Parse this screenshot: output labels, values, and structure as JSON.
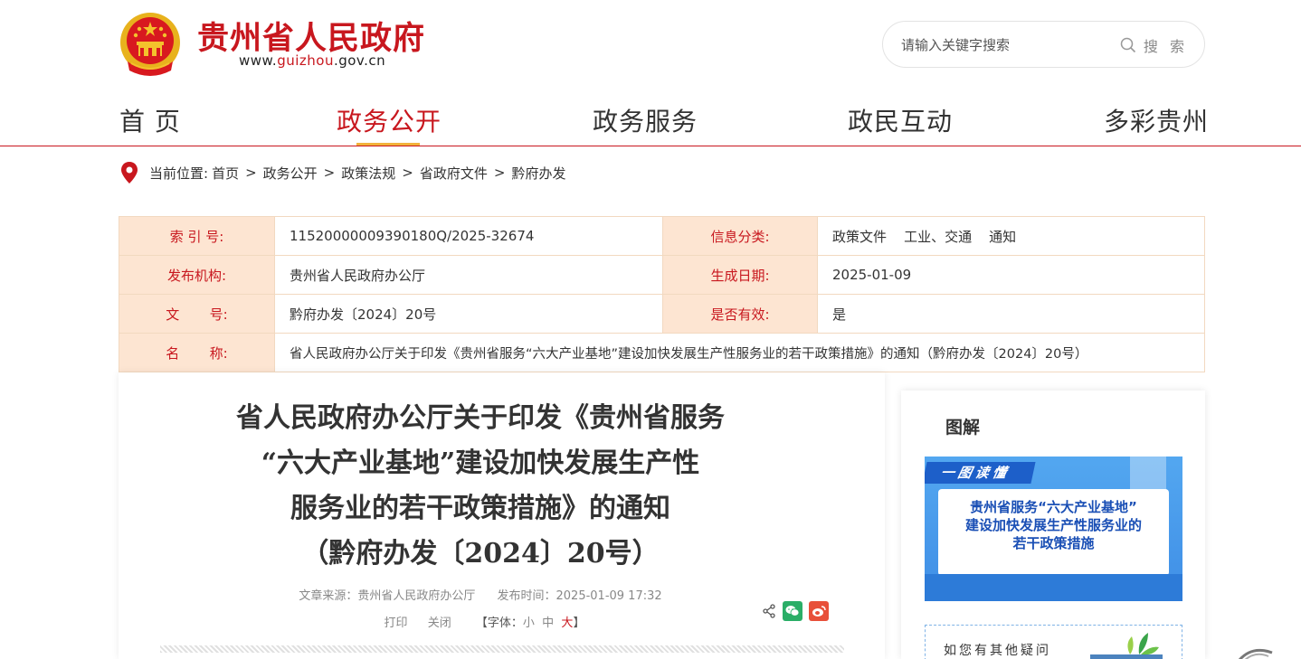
{
  "header": {
    "site_name": "贵州省人民政府",
    "url_prefix": "www.",
    "url_brand": "guizhou",
    "url_suffix": ".gov.cn",
    "emblem_icon": "national-emblem-icon",
    "search_placeholder": "请输入关键字搜索",
    "search_label": "搜 索"
  },
  "nav": {
    "items": [
      {
        "label": "首 页"
      },
      {
        "label": "政务公开"
      },
      {
        "label": "政务服务"
      },
      {
        "label": "政民互动"
      },
      {
        "label": "多彩贵州"
      }
    ],
    "active_index": 1
  },
  "breadcrumb": {
    "prefix": "当前位置:",
    "items": [
      "首页",
      "政务公开",
      "政策法规",
      "省政府文件",
      "黔府办发"
    ],
    "separator": ">"
  },
  "info": {
    "index_label": "索 引 号:",
    "index_value": "11520000009390180Q/2025-32674",
    "category_label": "信息分类:",
    "category_value": "政策文件    工业、交通    通知",
    "publisher_label": "发布机构:",
    "publisher_value": "贵州省人民政府办公厅",
    "date_label": "生成日期:",
    "date_value": "2025-01-09",
    "docno_label": "文       号:",
    "docno_value": "黔府办发〔2024〕20号",
    "valid_label": "是否有效:",
    "valid_value": "是",
    "name_label": "名       称:",
    "name_value": "省人民政府办公厅关于印发《贵州省服务“六大产业基地”建设加快发展生产性服务业的若干政策措施》的通知（黔府办发〔2024〕20号）"
  },
  "article": {
    "title_lines": [
      "省人民政府办公厅关于印发《贵州省服务",
      "“六大产业基地”建设加快发展生产性",
      "服务业的若干政策措施》的通知",
      "（黔府办发〔2024〕20号）"
    ],
    "source": "文章来源：贵州省人民政府办公厅",
    "publish_time": "发布时间：2025-01-09 17:32",
    "print_label": "打印",
    "close_label": "关闭",
    "font_prefix": "【字体：",
    "font_small": "小",
    "font_mid": "中",
    "font_big": "大",
    "font_suffix": "】"
  },
  "sidebar": {
    "title": "图解",
    "graphic_tag": "一图读懂",
    "graphic_lines": [
      "贵州省服务“六大产业基地”",
      "建设加快发展生产性服务业的",
      "若干政策措施"
    ],
    "qa_text": "如您有其他疑问"
  },
  "colors": {
    "brand_red": "#c8171e",
    "nav_accent": "#f2b23a",
    "table_label_bg": "#fde5d2",
    "wechat_green": "#2aae67",
    "weibo_red": "#e8503a"
  }
}
